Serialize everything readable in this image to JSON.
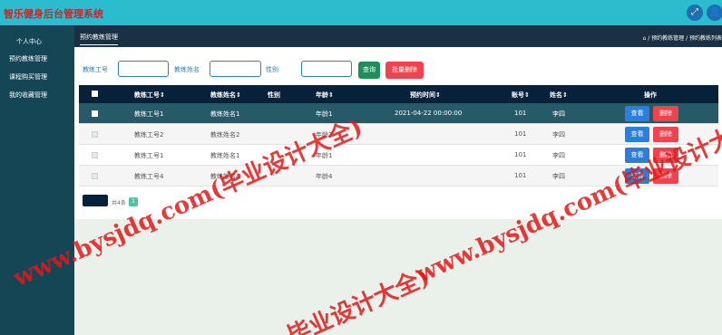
{
  "app": {
    "title": "智乐健身后台管理系统"
  },
  "header_icons": [
    "fullscreen-icon",
    "user-icon"
  ],
  "header": {
    "fullscreen_glyph": "⤢",
    "user_glyph": "👤"
  },
  "sidebar": {
    "items": [
      {
        "label": "个人中心"
      },
      {
        "label": "预约教练管理"
      },
      {
        "label": "课程购买管理"
      },
      {
        "label": "我的收藏管理"
      }
    ]
  },
  "breadcrumb": {
    "tab": "预约教练管理",
    "home_glyph": "⌂",
    "path": "/ 预约教练管理 / 预约教练列表"
  },
  "search": {
    "coach_id_label": "教练工号",
    "coach_name_label": "教练姓名",
    "gender_label": "性别",
    "query_button": "查询",
    "batch_delete_button": "批量删除"
  },
  "table": {
    "headers": [
      "教练工号⇕",
      "教练姓名⇕",
      "性别",
      "年龄⇕",
      "预约时间⇕",
      "账号⇕",
      "姓名⇕",
      "操作"
    ],
    "rows": [
      {
        "coach_id": "教练工号1",
        "coach_name": "教练姓名1",
        "gender": "",
        "age": "年龄1",
        "time": "2021-04-22 00:00:00",
        "account": "101",
        "name": "李四"
      },
      {
        "coach_id": "教练工号2",
        "coach_name": "教练姓名2",
        "gender": "",
        "age": "年龄2",
        "time": "",
        "account": "101",
        "name": "李四"
      },
      {
        "coach_id": "教练工号1",
        "coach_name": "教练姓名1",
        "gender": "",
        "age": "年龄1",
        "time": "",
        "account": "101",
        "name": "李四"
      },
      {
        "coach_id": "教练工号4",
        "coach_name": "教练姓名4",
        "gender": "",
        "age": "年龄4",
        "time": "",
        "account": "101",
        "name": "李四"
      }
    ],
    "view_button": "查看",
    "delete_button": "删除"
  },
  "pagination": {
    "total_text": "共4条",
    "current_page": "1"
  },
  "watermarks": [
    "www.bysjdq.com(毕业设计大全)",
    "www.bysjdq.com(毕业设计大全)",
    "毕业设计大全)"
  ],
  "colors": {
    "topbar": "#2bbccd",
    "sidebar": "#154656",
    "table_header": "#08213a",
    "highlight_row": "#275a68",
    "view": "#2c7fd8",
    "delete": "#f0434f",
    "query": "#1c8f5a"
  }
}
